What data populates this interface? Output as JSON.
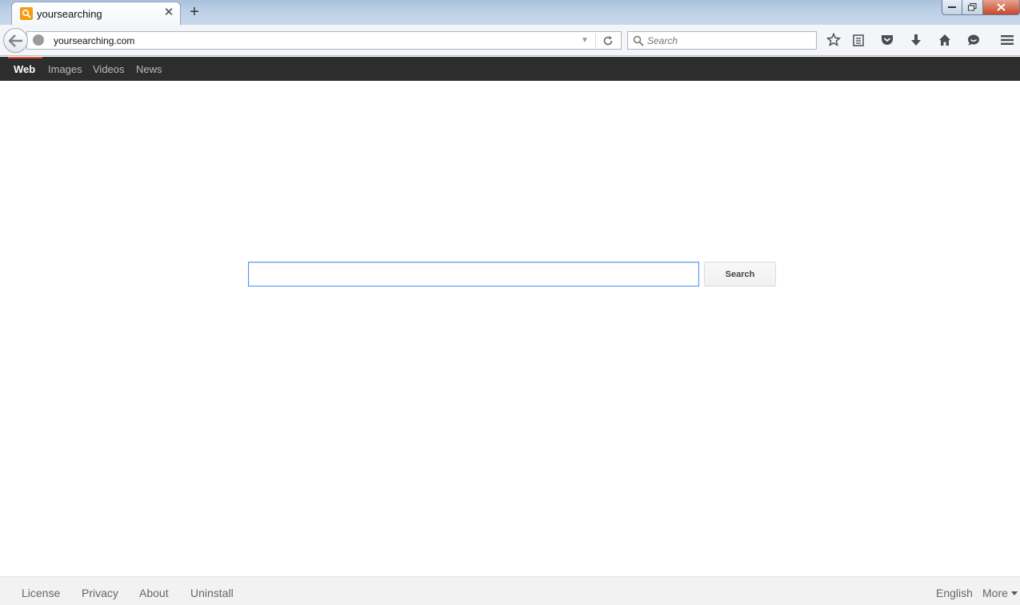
{
  "browser": {
    "tab_title": "yoursearching",
    "tab_close": "✕",
    "new_tab": "+",
    "url": "yoursearching.com",
    "search_placeholder": "Search"
  },
  "page_nav": {
    "items": [
      {
        "label": "Web",
        "active": true
      },
      {
        "label": "Images",
        "active": false
      },
      {
        "label": "Videos",
        "active": false
      },
      {
        "label": "News",
        "active": false
      }
    ]
  },
  "search": {
    "value": "",
    "button_label": "Search"
  },
  "footer": {
    "left_links": [
      "License",
      "Privacy",
      "About",
      "Uninstall"
    ],
    "language": "English",
    "more": "More"
  },
  "colors": {
    "nav_bg": "#2d2d2d",
    "nav_active_accent": "#dd4b39",
    "favicon": "#f39c12",
    "input_focus_border": "#4d90fe"
  }
}
